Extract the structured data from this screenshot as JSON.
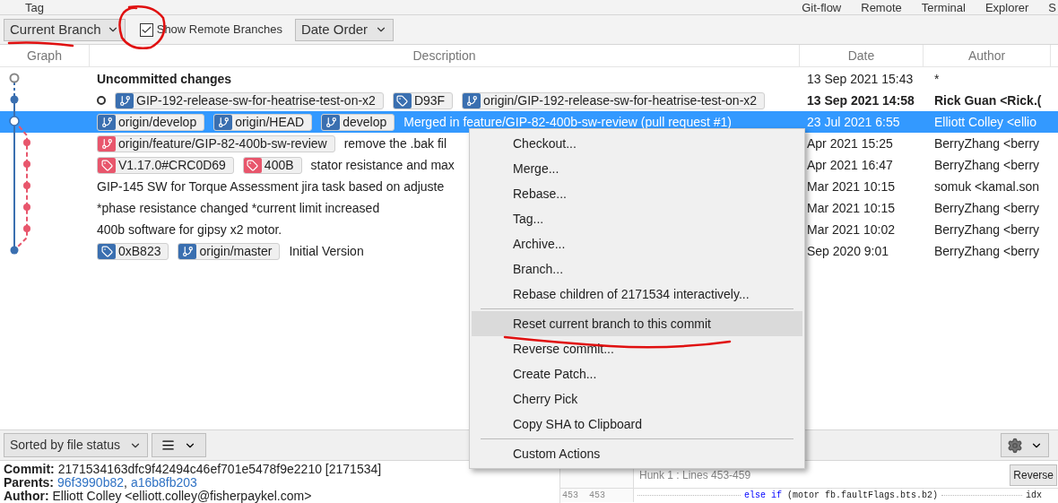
{
  "top_menu": {
    "left": [
      "Tag"
    ],
    "right": [
      "Git-flow",
      "Remote",
      "Terminal",
      "Explorer",
      "S"
    ]
  },
  "toolbar": {
    "branch_filter": "Current Branch",
    "show_remote": {
      "label": "Show Remote Branches",
      "checked": true
    },
    "order": "Date Order"
  },
  "columns": [
    "Graph",
    "Description",
    "Date",
    "Author"
  ],
  "commits": [
    {
      "kind": "uncommitted",
      "selected": false,
      "description": "Uncommitted changes",
      "date": "13 Sep 2021 15:43",
      "author": "*"
    },
    {
      "kind": "head",
      "selected": false,
      "refs": [
        {
          "kind": "branch",
          "label": "GIP-192-release-sw-for-heatrise-test-on-x2",
          "color": "#3a6fb0"
        },
        {
          "kind": "tag",
          "label": "D93F",
          "color": "#3a6fb0"
        },
        {
          "kind": "branch",
          "label": "origin/GIP-192-release-sw-for-heatrise-test-on-x2",
          "color": "#3a6fb0"
        }
      ],
      "date": "13 Sep 2021 14:58",
      "author": "Rick Guan <Rick.("
    },
    {
      "kind": "commit",
      "selected": true,
      "refs": [
        {
          "kind": "branch",
          "label": "origin/develop",
          "color": "#3a6fb0"
        },
        {
          "kind": "branch",
          "label": "origin/HEAD",
          "color": "#3a6fb0"
        },
        {
          "kind": "branch",
          "label": "develop",
          "color": "#3a6fb0"
        }
      ],
      "description": "Merged in feature/GIP-82-400b-sw-review (pull request #1)",
      "date": "23 Jul 2021 6:55",
      "author": "Elliott Colley <ellio"
    },
    {
      "kind": "commit",
      "selected": false,
      "refs": [
        {
          "kind": "branch",
          "label": "origin/feature/GIP-82-400b-sw-review",
          "color": "#e8566c"
        }
      ],
      "description": "remove the .bak fil",
      "date": "Apr 2021 15:25",
      "author": "BerryZhang <berry"
    },
    {
      "kind": "commit",
      "selected": false,
      "refs": [
        {
          "kind": "tag",
          "label": "V1.17.0#CRC0D69",
          "color": "#e8566c"
        },
        {
          "kind": "tag",
          "label": "400B",
          "color": "#e8566c"
        }
      ],
      "description": "stator resistance and max",
      "date": "Apr 2021 16:47",
      "author": "BerryZhang <berry"
    },
    {
      "kind": "commit",
      "selected": false,
      "description": "GIP-145 SW for Torque Assessment jira task based on adjuste",
      "date": "Mar 2021 10:15",
      "author": "somuk <kamal.son"
    },
    {
      "kind": "commit",
      "selected": false,
      "description": "*phase resistance changed *current limit increased",
      "date": "Mar 2021 10:15",
      "author": "BerryZhang <berry"
    },
    {
      "kind": "commit",
      "selected": false,
      "description": "400b software for gipsy x2 motor.",
      "date": "Mar 2021 10:02",
      "author": "BerryZhang <berry"
    },
    {
      "kind": "commit",
      "selected": false,
      "refs": [
        {
          "kind": "tag",
          "label": "0xB823",
          "color": "#3a6fb0"
        },
        {
          "kind": "branch",
          "label": "origin/master",
          "color": "#3a6fb0"
        }
      ],
      "description": "Initial Version",
      "date": "Sep 2020 9:01",
      "author": "BerryZhang <berry"
    }
  ],
  "context_menu": [
    {
      "kind": "item",
      "label": "Checkout...",
      "selected": false
    },
    {
      "kind": "item",
      "label": "Merge...",
      "selected": false
    },
    {
      "kind": "item",
      "label": "Rebase...",
      "selected": false
    },
    {
      "kind": "item",
      "label": "Tag...",
      "selected": false
    },
    {
      "kind": "item",
      "label": "Archive...",
      "selected": false
    },
    {
      "kind": "item",
      "label": "Branch...",
      "selected": false
    },
    {
      "kind": "item",
      "label": "Rebase children of 2171534 interactively...",
      "selected": false
    },
    {
      "kind": "separator"
    },
    {
      "kind": "item",
      "label": "Reset current branch to this commit",
      "selected": true
    },
    {
      "kind": "item",
      "label": "Reverse commit...",
      "selected": false
    },
    {
      "kind": "item",
      "label": "Create Patch...",
      "selected": false
    },
    {
      "kind": "item",
      "label": "Cherry Pick",
      "selected": false
    },
    {
      "kind": "item",
      "label": "Copy SHA to Clipboard",
      "selected": false
    },
    {
      "kind": "separator"
    },
    {
      "kind": "item",
      "label": "Custom Actions",
      "selected": false
    }
  ],
  "file_toolbar": {
    "sort": "Sorted by file status"
  },
  "commit_details": {
    "commit_label": "Commit:",
    "commit": "2171534163dfc9f42494c46ef701e5478f9e2210 [2171534]",
    "parents_label": "Parents:",
    "parents": [
      "96f3990b82",
      "a16b8fb203"
    ],
    "parents_separator": ",",
    "author_label": "Author:",
    "author": "Elliott Colley <elliott.colley@fisherpaykel.com>"
  },
  "diff": {
    "hunk": "Hunk 1 : Lines 453-459",
    "reverse_button": "Reverse",
    "lines": [
      {
        "old": "453",
        "new": "453",
        "tokens": [
          {
            "kind": "keyword",
            "text": "else if"
          },
          {
            "kind": "plain",
            "text": " (motor fb.faultFlags.bts.b2)"
          }
        ],
        "tail": "idx"
      }
    ]
  }
}
